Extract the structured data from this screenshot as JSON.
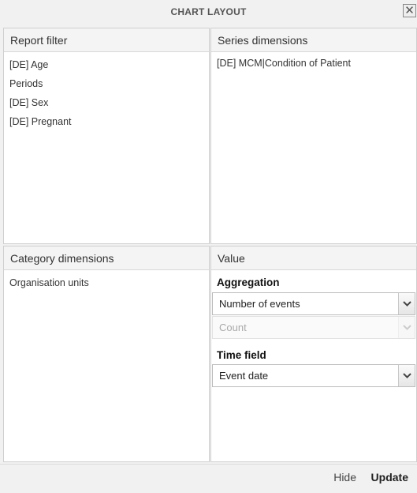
{
  "window": {
    "title": "CHART LAYOUT",
    "close_glyph": "✕"
  },
  "report_filter": {
    "header": "Report filter",
    "items": [
      "[DE] Age",
      "Periods",
      "[DE] Sex",
      "[DE] Pregnant"
    ]
  },
  "series_dimensions": {
    "header": "Series dimensions",
    "items": [
      "[DE] MCM|Condition of Patient"
    ]
  },
  "category_dimensions": {
    "header": "Category dimensions",
    "items": [
      "Organisation units"
    ]
  },
  "value": {
    "header": "Value",
    "aggregation_label": "Aggregation",
    "aggregation_value": "Number of events",
    "aggregation_sub_value": "Count",
    "time_field_label": "Time field",
    "time_field_value": "Event date"
  },
  "footer": {
    "hide_label": "Hide",
    "update_label": "Update"
  },
  "icons": {
    "close": "close-icon",
    "dropdown": "chevron-down-icon"
  }
}
